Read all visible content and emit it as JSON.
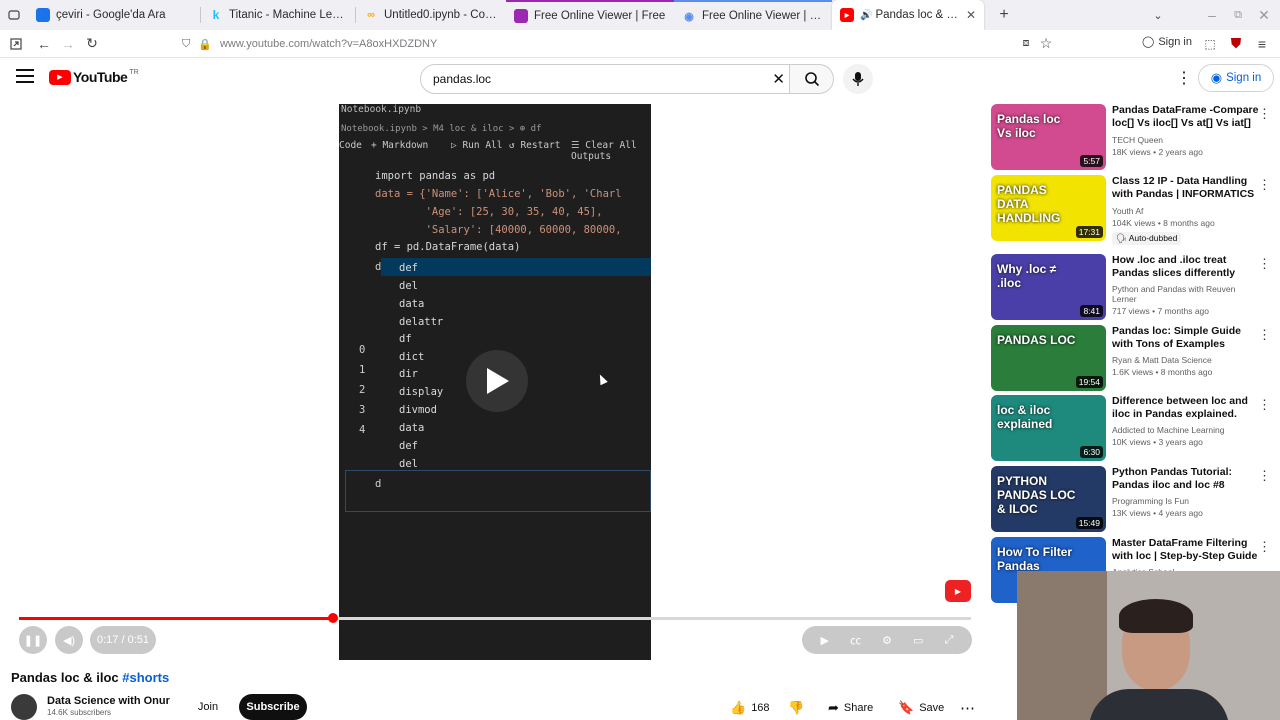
{
  "browser": {
    "tabs": [
      {
        "title": "çeviri - Google'da Ara",
        "icon": "google-icon",
        "color": "#1a73e8"
      },
      {
        "title": "Titanic - Machine Learning",
        "icon": "kaggle-icon",
        "color": "#20beff"
      },
      {
        "title": "Untitled0.ipynb - Colab",
        "icon": "colab-icon",
        "color": "#f9ab00"
      },
      {
        "title": "Free Online Viewer | Free",
        "icon": "viewer-icon",
        "color": "#9c27b0"
      },
      {
        "title": "Free Online Viewer | Free",
        "icon": "viewer-icon",
        "color": "#5b8def"
      },
      {
        "title": "Pandas loc & iloc #sho",
        "icon": "youtube-icon",
        "color": "#ff0000",
        "active": true
      }
    ],
    "url": "www.youtube.com/watch?v=A8oxHXDZDNY",
    "sign_in": "Sign in"
  },
  "youtube": {
    "logo": "YouTube",
    "region": "TR",
    "search_value": "pandas.loc",
    "sign_in": "Sign in"
  },
  "video": {
    "notebook_title": "Notebook.ipynb",
    "breadcrumb": "Notebook.ipynb > M4 loc & iloc > ⊕ df",
    "toolbar": {
      "code": "Code",
      "markdown": "+ Markdown",
      "run_all": "▷ Run All",
      "restart": "↺ Restart",
      "clear": "☰ Clear All Outputs"
    },
    "code_lines": [
      "import pandas as pd",
      "data = {'Name': ['Alice', 'Bob', 'Charl",
      "        'Age': [25, 30, 35, 40, 45],",
      "        'Salary': [40000, 60000, 80000,",
      "df = pd.DataFrame(data)"
    ],
    "typed_prefix": "d",
    "autocomplete": [
      "def",
      "del",
      "data",
      "delattr",
      "df",
      "dict",
      "dir",
      "display",
      "divmod",
      "data",
      "def",
      "del"
    ],
    "row_numbers": [
      "0",
      "1",
      "2",
      "3",
      "4"
    ],
    "cursor_text": "d",
    "time": "0:17 / 0:51",
    "progress": 0.33
  },
  "title": {
    "text": "Pandas loc & iloc ",
    "hashtag": "#shorts"
  },
  "channel": {
    "name": "Data Science with Onur",
    "subscribers": "14.6K subscribers",
    "join": "Join",
    "subscribe": "Subscribe"
  },
  "actions": {
    "likes": "168",
    "share": "Share",
    "save": "Save"
  },
  "recommendations": [
    {
      "title": "Pandas DataFrame -Compare loc[] Vs iloc[] Vs at[] Vs iat[] wit...",
      "channel": "TECH Queen",
      "views": "18K views • 2 years ago",
      "duration": "5:57",
      "thumb_text": "Pandas loc Vs iloc",
      "thumb_color": "#d24a8f"
    },
    {
      "title": "Class 12 IP - Data Handling with Pandas | INFORMATICS ...",
      "channel": "Youth Af",
      "views": "104K views • 8 months ago",
      "badge": "Auto-dubbed",
      "duration": "17:31",
      "thumb_text": "PANDAS DATA HANDLING",
      "thumb_color": "#f2e400"
    },
    {
      "title": "How .loc and .iloc treat Pandas slices differently",
      "channel": "Python and Pandas with Reuven Lerner",
      "views": "717 views • 7 months ago",
      "duration": "8:41",
      "thumb_text": "Why .loc ≠ .iloc",
      "thumb_color": "#4a3fa8"
    },
    {
      "title": "Pandas loc: Simple Guide with Tons of Examples",
      "channel": "Ryan & Matt Data Science",
      "views": "1.6K views • 8 months ago",
      "duration": "19:54",
      "thumb_text": "PANDAS LOC",
      "thumb_color": "#2a7d3a"
    },
    {
      "title": "Difference between loc and iloc in Pandas explained.",
      "channel": "Addicted to Machine Learning",
      "views": "10K views • 3 years ago",
      "duration": "6:30",
      "thumb_text": "loc & iloc explained",
      "thumb_color": "#1d8a7d"
    },
    {
      "title": "Python Pandas Tutorial: Pandas iloc and loc #8",
      "channel": "Programming Is Fun",
      "views": "13K views • 4 years ago",
      "duration": "15:49",
      "thumb_text": "PYTHON PANDAS LOC & ILOC",
      "thumb_color": "#243a66"
    },
    {
      "title": "Master DataFrame Filtering with loc | Step-by-Step Guide",
      "channel": "Analytics School",
      "views": "",
      "duration": "",
      "thumb_text": "How To Filter Pandas",
      "thumb_color": "#1f62c9"
    }
  ]
}
